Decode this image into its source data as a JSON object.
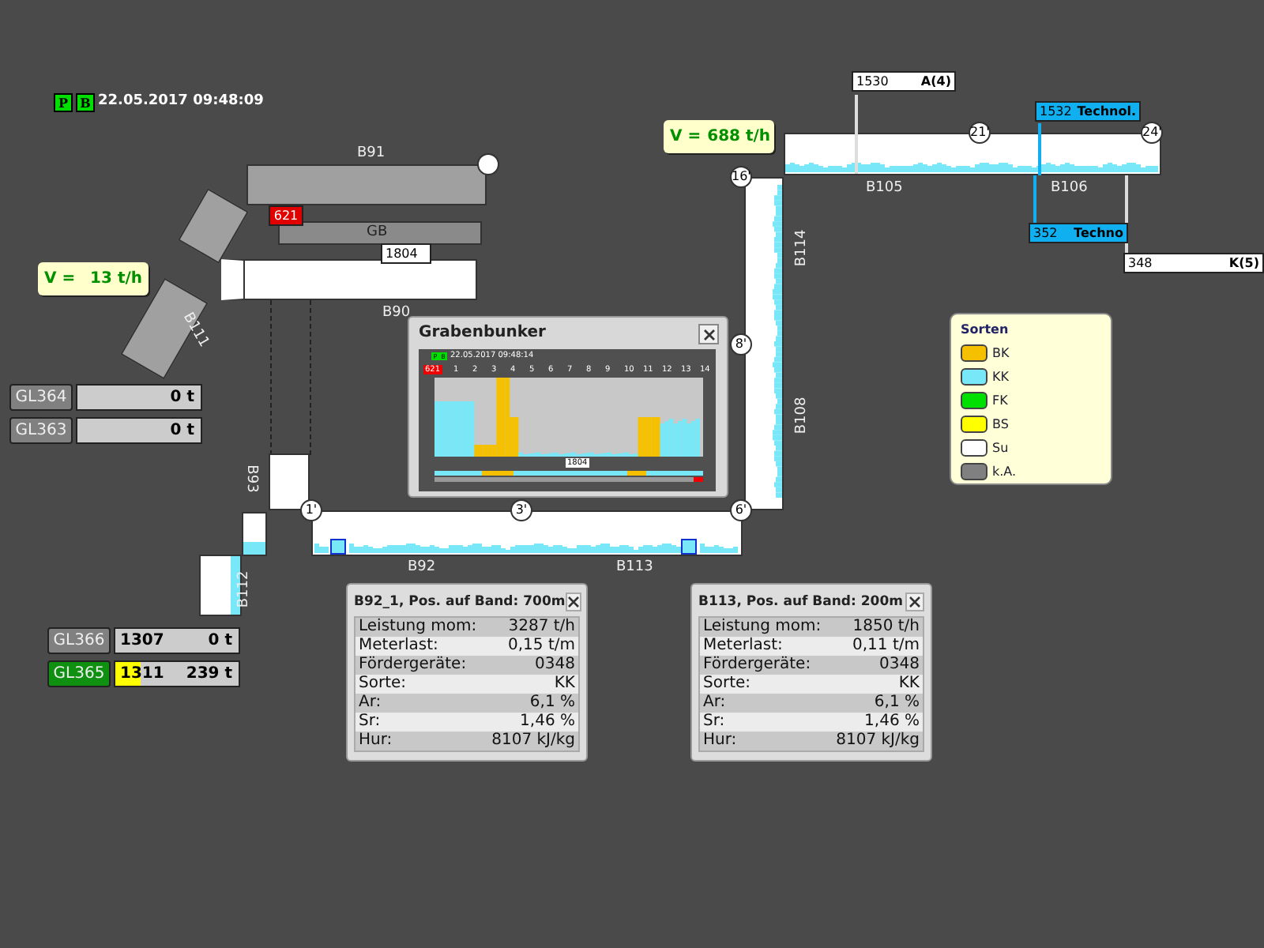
{
  "header": {
    "badges": [
      "P",
      "B"
    ],
    "timestamp": "22.05.2017 09:48:09"
  },
  "speed_boxes": [
    {
      "label": "V =",
      "value": "13 t/h"
    },
    {
      "label": "V =",
      "value": "688 t/h"
    }
  ],
  "belt_labels": [
    "B91",
    "GB",
    "B90",
    "B111",
    "B93",
    "B112",
    "B92",
    "B113",
    "B114",
    "B108",
    "B105",
    "B106"
  ],
  "position_markers": [
    "16'",
    "21'",
    "24'",
    "8'",
    "1'",
    "3'",
    "6'"
  ],
  "tags": [
    {
      "kind": "alarm",
      "value": "621"
    },
    {
      "kind": "normal",
      "value": "1804"
    },
    {
      "kind": "normal",
      "value": "1530",
      "note": "A(4)"
    },
    {
      "kind": "technol",
      "value": "1532",
      "note": "Technol."
    },
    {
      "kind": "technol",
      "value": "352",
      "note": "Techno"
    },
    {
      "kind": "normal",
      "value": "348",
      "note": "K(5)"
    }
  ],
  "stock_piles": [
    {
      "name": "GL364",
      "active": false,
      "amount": "0 t"
    },
    {
      "name": "GL363",
      "active": false,
      "amount": "0 t"
    },
    {
      "name": "GL366",
      "active": false,
      "code": "1307",
      "amount": "0 t"
    },
    {
      "name": "GL365",
      "active": true,
      "level": 0.2,
      "code": "1311",
      "amount": "239 t"
    }
  ],
  "grabenbunker": {
    "title": "Grabenbunker",
    "badges": [
      "P",
      "B"
    ],
    "timestamp": "22.05.2017 09:48:14",
    "marker": "621",
    "positions": [
      "1",
      "2",
      "3",
      "4",
      "5",
      "6",
      "7",
      "8",
      "9",
      "10",
      "11",
      "12",
      "13",
      "14"
    ],
    "level_tag": "1804"
  },
  "info_panels": [
    {
      "title": "B92_1, Pos. auf Band: 700m",
      "rows": [
        {
          "label": "Leistung mom:",
          "value": "3287 t/h"
        },
        {
          "label": "Meterlast:",
          "value": "0,15 t/m"
        },
        {
          "label": "Fördergeräte:",
          "value": "0348"
        },
        {
          "label": "Sorte:",
          "value": "KK"
        },
        {
          "label": "Ar:",
          "value": "6,1 %"
        },
        {
          "label": "Sr:",
          "value": "1,46 %"
        },
        {
          "label": "Hur:",
          "value": "8107 kJ/kg"
        }
      ]
    },
    {
      "title": "B113, Pos. auf Band: 200m",
      "rows": [
        {
          "label": "Leistung mom:",
          "value": "1850 t/h"
        },
        {
          "label": "Meterlast:",
          "value": "0,11 t/m"
        },
        {
          "label": "Fördergeräte:",
          "value": "0348"
        },
        {
          "label": "Sorte:",
          "value": "KK"
        },
        {
          "label": "Ar:",
          "value": "6,1 %"
        },
        {
          "label": "Sr:",
          "value": "1,46 %"
        },
        {
          "label": "Hur:",
          "value": "8107 kJ/kg"
        }
      ]
    }
  ],
  "legend": {
    "title": "Sorten",
    "items": [
      {
        "label": "BK",
        "color": "#f5c000"
      },
      {
        "label": "KK",
        "color": "#78e8f8"
      },
      {
        "label": "FK",
        "color": "#00e000"
      },
      {
        "label": "BS",
        "color": "#ffff00"
      },
      {
        "label": "Su",
        "color": "#ffffff"
      },
      {
        "label": "k.A.",
        "color": "#808080"
      }
    ]
  }
}
